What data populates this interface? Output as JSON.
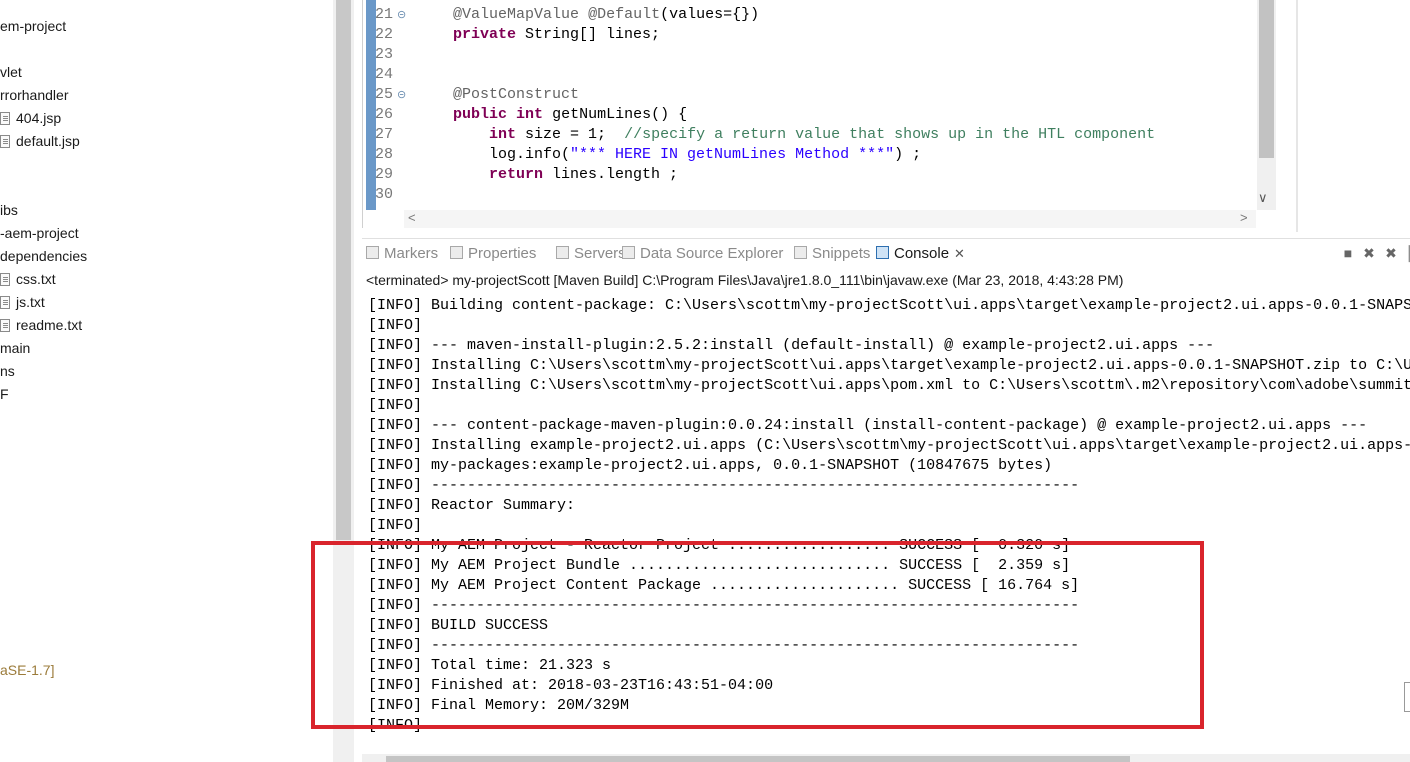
{
  "explorer": {
    "items": [
      {
        "label": "em-project",
        "type": "folder"
      },
      {
        "label": "vlet",
        "type": "folder"
      },
      {
        "label": "rrorhandler",
        "type": "folder"
      },
      {
        "label": "404.jsp",
        "type": "file"
      },
      {
        "label": "default.jsp",
        "type": "file"
      },
      {
        "label": "ibs",
        "type": "folder"
      },
      {
        "label": "-aem-project",
        "type": "folder"
      },
      {
        "label": "dependencies",
        "type": "folder"
      },
      {
        "label": "css.txt",
        "type": "file"
      },
      {
        "label": "js.txt",
        "type": "file"
      },
      {
        "label": "readme.txt",
        "type": "file"
      },
      {
        "label": "main",
        "type": "folder"
      },
      {
        "label": "ns",
        "type": "folder"
      },
      {
        "label": "F",
        "type": "folder"
      },
      {
        "label": "aSE-1.7]",
        "type": "jre"
      }
    ]
  },
  "editor": {
    "lines": [
      {
        "num": "21",
        "fold": true,
        "text": "    @ValueMapValue @Default(values={})"
      },
      {
        "num": "22",
        "fold": false,
        "text": "    private String[] lines;"
      },
      {
        "num": "23",
        "fold": false,
        "text": ""
      },
      {
        "num": "24",
        "fold": false,
        "text": ""
      },
      {
        "num": "25",
        "fold": true,
        "text": "    @PostConstruct"
      },
      {
        "num": "26",
        "fold": false,
        "text": "    public int getNumLines() {"
      },
      {
        "num": "27",
        "fold": false,
        "text": "        int size = 1;  //specify a return value that shows up in the HTL component"
      },
      {
        "num": "28",
        "fold": false,
        "text": "        log.info(\"*** HERE IN getNumLines Method ***\") ;"
      },
      {
        "num": "29",
        "fold": false,
        "text": "        return lines.length ;"
      },
      {
        "num": "30",
        "fold": false,
        "text": ""
      }
    ]
  },
  "views": {
    "tabs": [
      {
        "label": "Markers",
        "icon": "markers-icon",
        "active": false
      },
      {
        "label": "Properties",
        "icon": "properties-icon",
        "active": false
      },
      {
        "label": "Servers",
        "icon": "servers-icon",
        "active": false
      },
      {
        "label": "Data Source Explorer",
        "icon": "data-source-icon",
        "active": false
      },
      {
        "label": "Snippets",
        "icon": "snippets-icon",
        "active": false
      },
      {
        "label": "Console",
        "icon": "console-icon",
        "active": true,
        "close": "✕"
      }
    ]
  },
  "console": {
    "status": "<terminated> my-projectScott [Maven Build] C:\\Program Files\\Java\\jre1.8.0_111\\bin\\javaw.exe (Mar 23, 2018, 4:43:28 PM)",
    "lines": [
      "[INFO] Building content-package: C:\\Users\\scottm\\my-projectScott\\ui.apps\\target\\example-project2.ui.apps-0.0.1-SNAPS",
      "[INFO]",
      "[INFO] --- maven-install-plugin:2.5.2:install (default-install) @ example-project2.ui.apps ---",
      "[INFO] Installing C:\\Users\\scottm\\my-projectScott\\ui.apps\\target\\example-project2.ui.apps-0.0.1-SNAPSHOT.zip to C:\\U",
      "[INFO] Installing C:\\Users\\scottm\\my-projectScott\\ui.apps\\pom.xml to C:\\Users\\scottm\\.m2\\repository\\com\\adobe\\summit",
      "[INFO]",
      "[INFO] --- content-package-maven-plugin:0.0.24:install (install-content-package) @ example-project2.ui.apps ---",
      "[INFO] Installing example-project2.ui.apps (C:\\Users\\scottm\\my-projectScott\\ui.apps\\target\\example-project2.ui.apps-",
      "[INFO] my-packages:example-project2.ui.apps, 0.0.1-SNAPSHOT (10847675 bytes)",
      "[INFO] ------------------------------------------------------------------------",
      "[INFO] Reactor Summary:",
      "[INFO]",
      "[INFO] My AEM Project - Reactor Project .................. SUCCESS [  0.320 s]",
      "[INFO] My AEM Project Bundle ............................. SUCCESS [  2.359 s]",
      "[INFO] My AEM Project Content Package ..................... SUCCESS [ 16.764 s]",
      "[INFO] ------------------------------------------------------------------------",
      "[INFO] BUILD SUCCESS",
      "[INFO] ------------------------------------------------------------------------",
      "[INFO] Total time: 21.323 s",
      "[INFO] Finished at: 2018-03-23T16:43:51-04:00",
      "[INFO] Final Memory: 20M/329M",
      "[INFO]"
    ]
  },
  "colors": {
    "highlight": "#d9242c",
    "keyword": "#7f0055",
    "comment": "#3f7f5f",
    "string": "#2a00ff"
  }
}
